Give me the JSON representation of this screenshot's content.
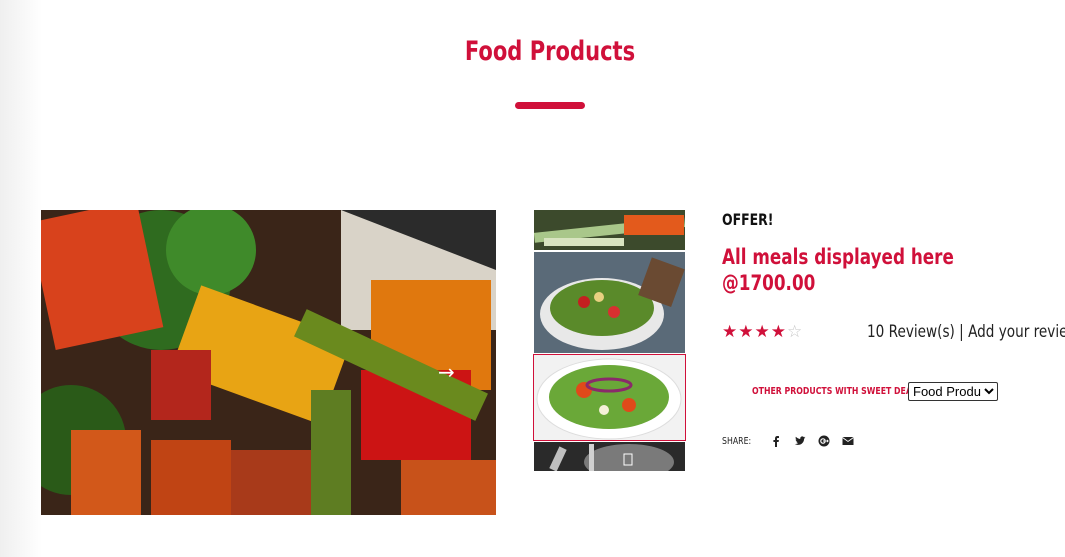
{
  "header": {
    "title": "Food Products"
  },
  "product": {
    "offer_label": "OFFER!",
    "name": "All meals displayed here",
    "price": "@1700.00",
    "rating": 4,
    "rating_max": 5,
    "reviews_text": "10 Review(s)",
    "separator": "|",
    "add_review": "Add your review"
  },
  "other_products": {
    "label": "OTHER PRODUCTS WITH SWEET DEALS",
    "selected": "Food Products",
    "options": [
      "Food Products"
    ]
  },
  "share": {
    "label": "SHARE:",
    "icons": [
      "facebook-icon",
      "twitter-icon",
      "google-plus-icon",
      "envelope-icon"
    ]
  },
  "gallery": {
    "next_glyph": "→",
    "main_alt": "stir-fried vegetables",
    "thumbnails": [
      "vegetables",
      "salad with bread",
      "salad bowl",
      "plate and cutlery"
    ],
    "active_thumbnail": 2
  },
  "colors": {
    "accent": "#d0103a",
    "text": "#222222",
    "star_empty": "#c8c8c8"
  }
}
